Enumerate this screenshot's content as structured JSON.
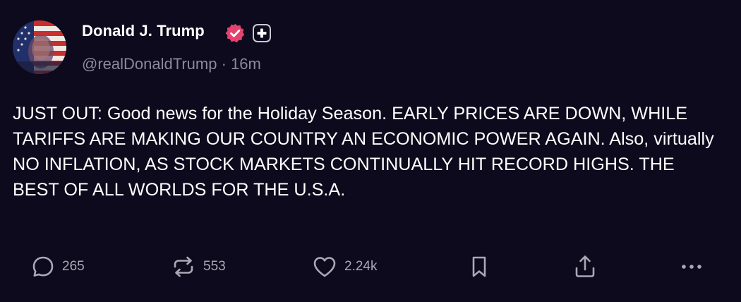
{
  "author": {
    "display_name": "Donald J. Trump",
    "handle": "@realDonaldTrump",
    "separator": "·",
    "time": "16m"
  },
  "post": {
    "text": "JUST OUT: Good news for the Holiday Season. EARLY PRICES ARE DOWN, WHILE TARIFFS ARE MAKING OUR COUNTRY AN ECONOMIC POWER AGAIN. Also, virtually NO INFLATION, AS STOCK MARKETS CONTINUALLY HIT RECORD HIGHS. THE BEST OF ALL WORLDS FOR THE U.S.A."
  },
  "actions": {
    "replies": "265",
    "reposts": "553",
    "likes": "2.24k"
  },
  "icons": {
    "verified": "verified-badge-icon",
    "follow": "plus-icon",
    "reply": "reply-bubble-icon",
    "repost": "repost-icon",
    "like": "heart-icon",
    "bookmark": "bookmark-icon",
    "share": "share-icon",
    "more": "more-icon"
  },
  "colors": {
    "background": "#0c0a1c",
    "verified": "#e3436d",
    "muted": "#8b8a9a",
    "action": "#a9a8b6"
  }
}
